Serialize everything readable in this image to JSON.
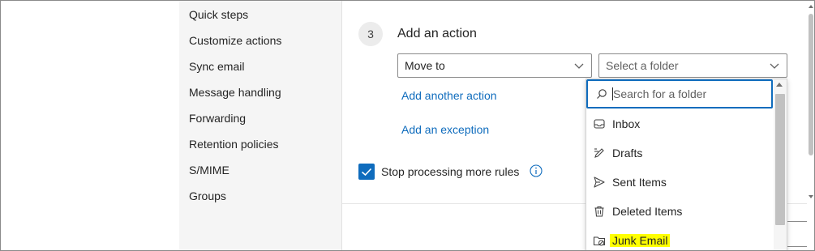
{
  "nav": {
    "items": [
      {
        "label": "Quick steps",
        "name": "nav-item-quick-steps"
      },
      {
        "label": "Customize actions",
        "name": "nav-item-customize-actions"
      },
      {
        "label": "Sync email",
        "name": "nav-item-sync-email"
      },
      {
        "label": "Message handling",
        "name": "nav-item-message-handling"
      },
      {
        "label": "Forwarding",
        "name": "nav-item-forwarding"
      },
      {
        "label": "Retention policies",
        "name": "nav-item-retention-policies"
      },
      {
        "label": "S/MIME",
        "name": "nav-item-smime"
      },
      {
        "label": "Groups",
        "name": "nav-item-groups"
      }
    ]
  },
  "step": {
    "number": "3",
    "title": "Add an action"
  },
  "action": {
    "selected": "Move to",
    "folder_placeholder": "Select a folder"
  },
  "links": {
    "add_another_action": "Add another action",
    "add_exception": "Add an exception"
  },
  "stop_processing": {
    "label": "Stop processing more rules",
    "checked": true
  },
  "folder_panel": {
    "search_placeholder": "Search for a folder",
    "folders": [
      {
        "label": "Inbox",
        "icon": "inbox-icon"
      },
      {
        "label": "Drafts",
        "icon": "drafts-icon"
      },
      {
        "label": "Sent Items",
        "icon": "send-icon"
      },
      {
        "label": "Deleted Items",
        "icon": "trash-icon"
      },
      {
        "label": "Junk Email",
        "icon": "junk-folder-icon",
        "highlighted": true
      }
    ]
  },
  "colors": {
    "accent": "#0f6cbd",
    "highlight": "#ffff00",
    "nav_background": "#f5f5f5"
  }
}
